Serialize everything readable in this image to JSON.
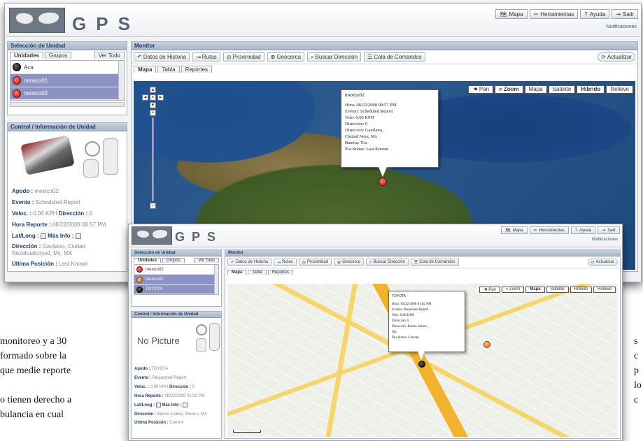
{
  "main_window": {
    "brand": "GPS",
    "toolbar": [
      {
        "icon": "map-icon",
        "label": "Mapa"
      },
      {
        "icon": "tools-icon",
        "label": "Herramientas"
      },
      {
        "icon": "help-icon",
        "label": "Ayuda"
      },
      {
        "icon": "exit-icon",
        "label": "Salir"
      }
    ],
    "notifications": "Notificaciones",
    "selection_panel": {
      "title": "Selección de Unidad",
      "tabs": [
        "Unidades",
        "Grupos",
        "Ver Todo"
      ],
      "units": [
        {
          "name": "Aca",
          "icon": "black",
          "selected": false
        },
        {
          "name": "mexico01",
          "icon": "red",
          "selected": true
        },
        {
          "name": "mexico02",
          "icon": "red",
          "selected": true
        }
      ]
    },
    "control_panel": {
      "title": "Control / Información de Unidad",
      "fields": [
        {
          "label": "Apodo :",
          "value": "mexico02"
        },
        {
          "label": "Evento :",
          "value": "Scheduled Report"
        },
        {
          "label": "Veloc. :",
          "value": "0.00 KPH",
          "label2": "Dirección :",
          "value2": "0"
        },
        {
          "label": "Hora Reporte :",
          "value": "08/22/2008 08:57 PM"
        },
        {
          "label": "Lat/Long :",
          "value": "",
          "label2": "Más Info :",
          "value2": ""
        },
        {
          "label": "Dirección :",
          "value": "Gavilano, Ciudad Nezahualcóyotl, Mx, MX"
        },
        {
          "label": "Ultima Posición :",
          "value": "Last Known"
        }
      ]
    },
    "monitor_panel": {
      "title": "Monitor",
      "actions": [
        "Datos de Historia",
        "Rutas",
        "Proximidad",
        "Geocerca",
        "Buscar Dirección",
        "Cola de Comandos"
      ],
      "refresh": "Actualizar",
      "tabs": [
        "Mapa",
        "Tabla",
        "Reportes"
      ],
      "map_types": [
        "Pan",
        "Zoom",
        "Mapa",
        "Satélite",
        "Híbrido",
        "Relieve"
      ],
      "active_map_type": "Híbrido",
      "popup": {
        "title": "mexico02",
        "lines": [
          "Hora: 08/22/2008 08:57 PM",
          "Evento: Scheduled Report",
          "Velo: 0.00 KPH",
          "Dirección: 0",
          "Dirección: Gavilano,",
          "Ciudad Neza, Mx",
          "Batería: N/a",
          "Pos.Status: Last Known"
        ]
      }
    }
  },
  "overlay_window": {
    "brand": "GPS",
    "toolbar": [
      "Mapa",
      "Herramientas",
      "Ayuda",
      "Salir"
    ],
    "notifications": "Notificaciones",
    "selection_panel": {
      "title": "Selección de Unidad",
      "tabs": [
        "Unidades",
        "Grupos",
        "Ver Todo"
      ],
      "units": [
        {
          "name": "mexico02",
          "icon": "red",
          "selected": false
        },
        {
          "name": "mexico01",
          "icon": "orange",
          "selected": true
        },
        {
          "name": "TOYOTA",
          "icon": "black",
          "selected": true
        }
      ]
    },
    "control_panel": {
      "title": "Control / Información de Unidad",
      "no_picture": "No Picture",
      "fields": [
        {
          "label": "Apodo :",
          "value": "TOYOTA"
        },
        {
          "label": "Evento :",
          "value": "Requested Report"
        },
        {
          "label": "Veloc. :",
          "value": "0.00 KPH",
          "label2": "Dirección :",
          "value2": "0"
        },
        {
          "label": "Hora Reporte :",
          "value": "08/22/2008 01:02 PM"
        },
        {
          "label": "Lat/Long :",
          "value": "",
          "label2": "Más Info :",
          "value2": ""
        },
        {
          "label": "Dirección :",
          "value": "Benito Juárez, Mexico, MX"
        },
        {
          "label": "Ultima Posición :",
          "value": "Current"
        }
      ]
    },
    "monitor_panel": {
      "title": "Monitor",
      "actions": [
        "Datos de Historia",
        "Rutas",
        "Proximidad",
        "Geocerca",
        "Buscar Dirección",
        "Cola de Comandos"
      ],
      "refresh": "Actualizar",
      "tabs": [
        "Mapa",
        "Tabla",
        "Reportes"
      ],
      "map_types": [
        "Pan",
        "Zoom",
        "Mapa",
        "Satélite",
        "Híbrido",
        "Relieve"
      ],
      "active_map_type": "Mapa",
      "popup": {
        "title": "TOYOTA",
        "lines": [
          "Hora: 08/22/2008 01:02 PM",
          "Evento: Requested Report",
          "Velo: 0.00 KPH",
          "Dirección: 0",
          "Dirección: Benito Juárez,",
          "Mx",
          "Pos.Status: Current"
        ]
      }
    }
  },
  "background_text": {
    "left": [
      "monitoreo y a 30",
      "formado sobre la",
      "que medie reporte",
      "",
      "o tienen derecho a",
      "bulancia en cual"
    ],
    "right": [
      "s",
      "c",
      "p",
      "lo",
      "c"
    ]
  }
}
